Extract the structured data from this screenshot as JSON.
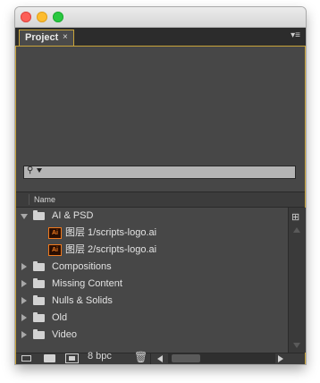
{
  "panel": {
    "tab_label": "Project",
    "tab_close": "×",
    "menu_glyph": "▾≡"
  },
  "search": {
    "placeholder": ""
  },
  "columns": {
    "name": "Name"
  },
  "tree": [
    {
      "type": "folder",
      "label": "AI & PSD",
      "expanded": true
    },
    {
      "type": "file",
      "icon": "Ai",
      "label": "图层 1/scripts-logo.ai"
    },
    {
      "type": "file",
      "icon": "Ai",
      "label": "图层 2/scripts-logo.ai"
    },
    {
      "type": "folder",
      "label": "Compositions",
      "expanded": false
    },
    {
      "type": "folder",
      "label": "Missing Content",
      "expanded": false
    },
    {
      "type": "folder",
      "label": "Nulls & Solids",
      "expanded": false
    },
    {
      "type": "folder",
      "label": "Old",
      "expanded": false
    },
    {
      "type": "folder",
      "label": "Video",
      "expanded": false
    }
  ],
  "bottombar": {
    "bpc_label": "8 bpc",
    "trash_glyph": "🗑"
  },
  "colors": {
    "panel_bg": "#474747",
    "active_border": "#c9a43a",
    "ai_orange": "#f07a1e"
  }
}
